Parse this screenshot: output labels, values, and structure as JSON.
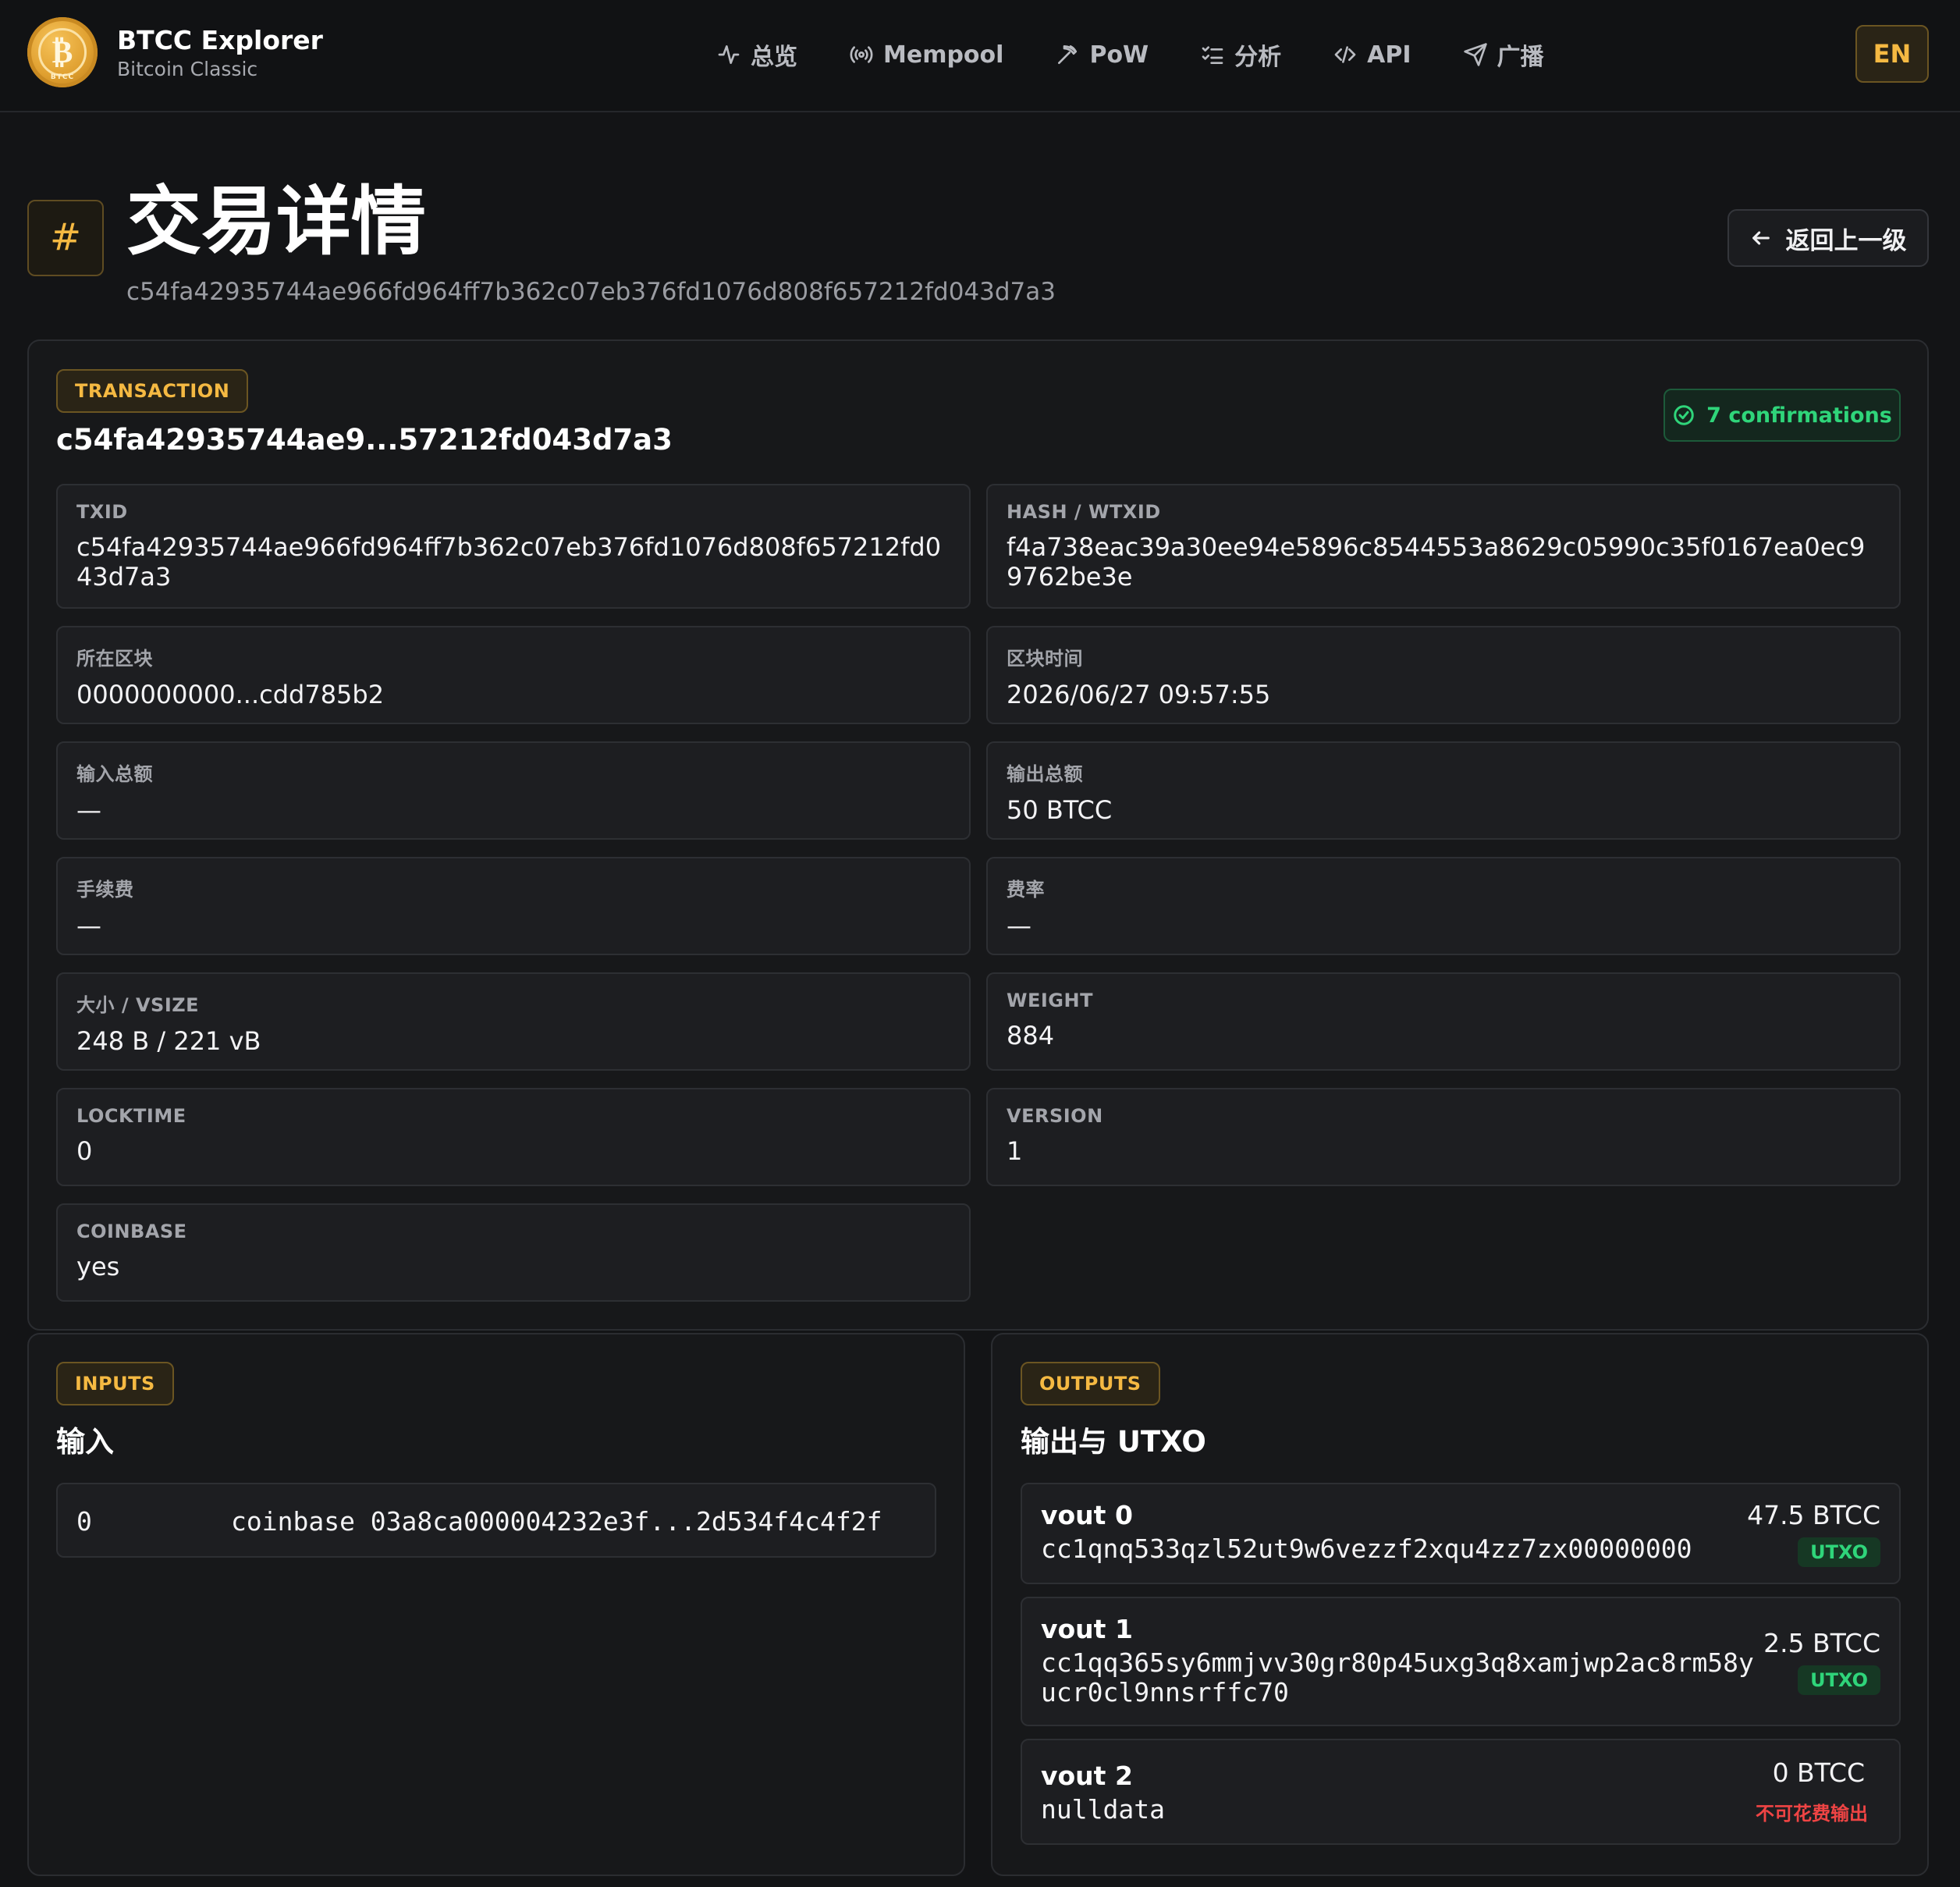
{
  "header": {
    "brand_title": "BTCC Explorer",
    "brand_subtitle": "Bitcoin Classic",
    "logo_text": "BTCC",
    "nav": [
      {
        "label": "总览",
        "icon": "activity-icon"
      },
      {
        "label": "Mempool",
        "icon": "broadcast-signal-icon"
      },
      {
        "label": "PoW",
        "icon": "pickaxe-icon"
      },
      {
        "label": "分析",
        "icon": "list-checks-icon"
      },
      {
        "label": "API",
        "icon": "code-icon"
      },
      {
        "label": "广播",
        "icon": "send-icon"
      }
    ],
    "lang_button": "EN"
  },
  "page": {
    "icon_glyph": "#",
    "title": "交易详情",
    "txid": "c54fa42935744ae966fd964ff7b362c07eb376fd1076d808f657212fd043d7a3",
    "back_button": "返回上一级"
  },
  "transaction": {
    "tag": "TRANSACTION",
    "short_id": "c54fa42935744ae9...57212fd043d7a3",
    "confirmations": "7 confirmations",
    "fields": [
      {
        "label": "TXID",
        "value": "c54fa42935744ae966fd964ff7b362c07eb376fd1076d808f657212fd043d7a3"
      },
      {
        "label": "HASH / WTXID",
        "value": "f4a738eac39a30ee94e5896c8544553a8629c05990c35f0167ea0ec99762be3e"
      },
      {
        "label": "所在区块",
        "value": "0000000000...cdd785b2"
      },
      {
        "label": "区块时间",
        "value": "2026/06/27 09:57:55"
      },
      {
        "label": "输入总额",
        "value": "—"
      },
      {
        "label": "输出总额",
        "value": "50 BTCC"
      },
      {
        "label": "手续费",
        "value": "—"
      },
      {
        "label": "费率",
        "value": "—"
      },
      {
        "label": "大小 / VSIZE",
        "value": "248 B / 221 vB"
      },
      {
        "label": "WEIGHT",
        "value": "884"
      },
      {
        "label": "LOCKTIME",
        "value": "0"
      },
      {
        "label": "VERSION",
        "value": "1"
      },
      {
        "label": "COINBASE",
        "value": "yes"
      }
    ]
  },
  "inputs": {
    "tag": "INPUTS",
    "heading": "输入",
    "items": [
      {
        "index": "0",
        "text": "coinbase 03a8ca000004232e3f...2d534f4c4f2f"
      }
    ]
  },
  "outputs": {
    "tag": "OUTPUTS",
    "heading": "输出与 UTXO",
    "items": [
      {
        "label": "vout 0",
        "address": "cc1qnq533qzl52ut9w6vezzf2xqu4zz7zx00000000",
        "amount": "47.5 BTCC",
        "status": "UTXO"
      },
      {
        "label": "vout 1",
        "address": "cc1qq365sy6mmjvv30gr80p45uxg3q8xamjwp2ac8rm58yucr0cl9nnsrffc70",
        "amount": "2.5 BTCC",
        "status": "UTXO"
      },
      {
        "label": "vout 2",
        "address": "nulldata",
        "amount": "0 BTCC",
        "status": "不可花费输出"
      }
    ]
  },
  "colors": {
    "accent_gold": "#f5b942",
    "success_green": "#2fd57a",
    "danger_red": "#ef4444",
    "background": "#131416"
  }
}
